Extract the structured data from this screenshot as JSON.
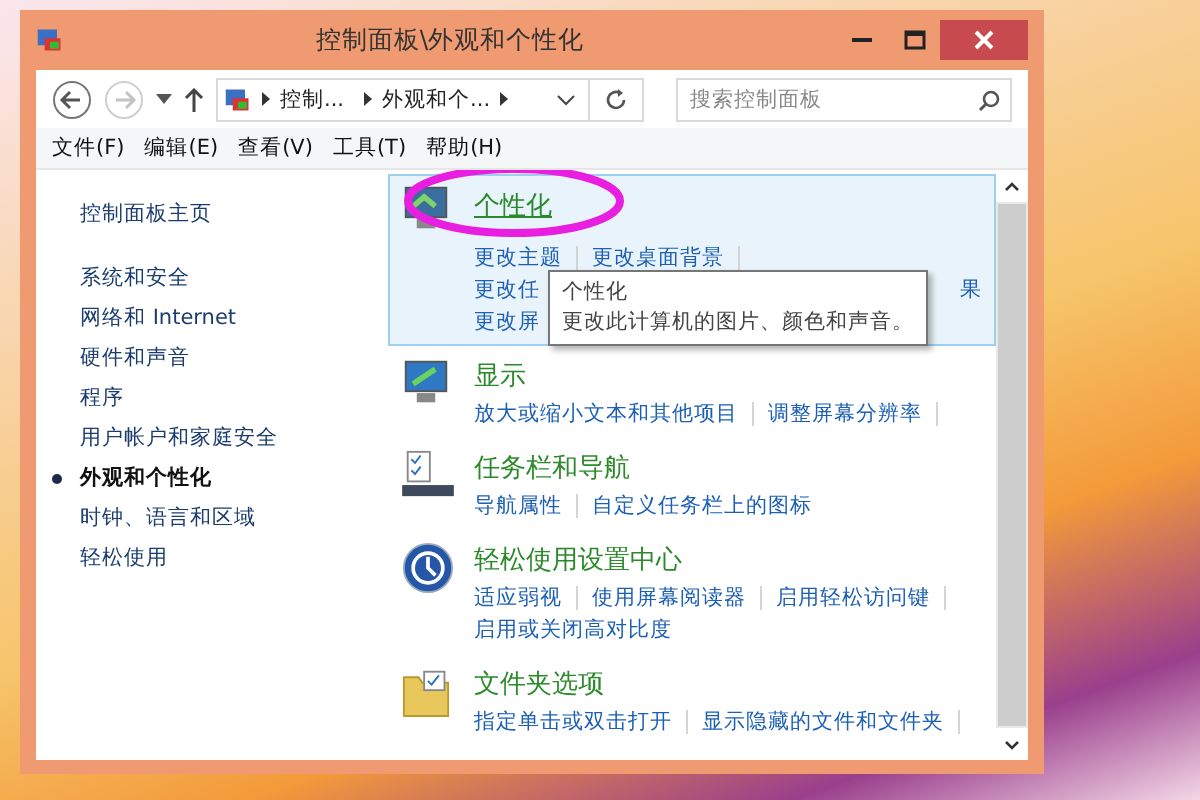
{
  "window": {
    "title": "控制面板\\外观和个性化"
  },
  "address": {
    "crumbs": [
      "控制...",
      "外观和个..."
    ],
    "search_placeholder": "搜索控制面板",
    "forward_disabled": true
  },
  "menu": [
    "文件(F)",
    "编辑(E)",
    "查看(V)",
    "工具(T)",
    "帮助(H)"
  ],
  "sidebar": {
    "home": "控制面板主页",
    "items": [
      {
        "label": "系统和安全",
        "selected": false
      },
      {
        "label": "网络和 Internet",
        "selected": false
      },
      {
        "label": "硬件和声音",
        "selected": false
      },
      {
        "label": "程序",
        "selected": false
      },
      {
        "label": "用户帐户和家庭安全",
        "selected": false
      },
      {
        "label": "外观和个性化",
        "selected": true
      },
      {
        "label": "时钟、语言和区域",
        "selected": false
      },
      {
        "label": "轻松使用",
        "selected": false
      }
    ]
  },
  "categories": [
    {
      "kind": "monitor",
      "title": "个性化",
      "highlighted": true,
      "circled": true,
      "link_rows": [
        [
          "更改主题",
          "更改桌面背景"
        ],
        [
          "更改任",
          "果"
        ],
        [
          "更改屏"
        ]
      ],
      "tooltip": {
        "title": "个性化",
        "text": "更改此计算机的图片、颜色和声音。"
      }
    },
    {
      "kind": "display",
      "title": "显示",
      "highlighted": false,
      "circled": false,
      "link_rows": [
        [
          "放大或缩小文本和其他项目",
          "调整屏幕分辨率"
        ]
      ]
    },
    {
      "kind": "taskbar",
      "title": "任务栏和导航",
      "highlighted": false,
      "circled": false,
      "link_rows": [
        [
          "导航属性",
          "自定义任务栏上的图标"
        ]
      ]
    },
    {
      "kind": "ease",
      "title": "轻松使用设置中心",
      "highlighted": false,
      "circled": false,
      "link_rows": [
        [
          "适应弱视",
          "使用屏幕阅读器",
          "启用轻松访问键"
        ],
        [
          "启用或关闭高对比度"
        ]
      ]
    },
    {
      "kind": "folder",
      "title": "文件夹选项",
      "highlighted": false,
      "circled": false,
      "link_rows": [
        [
          "指定单击或双击打开",
          "显示隐藏的文件和文件夹"
        ]
      ]
    }
  ]
}
